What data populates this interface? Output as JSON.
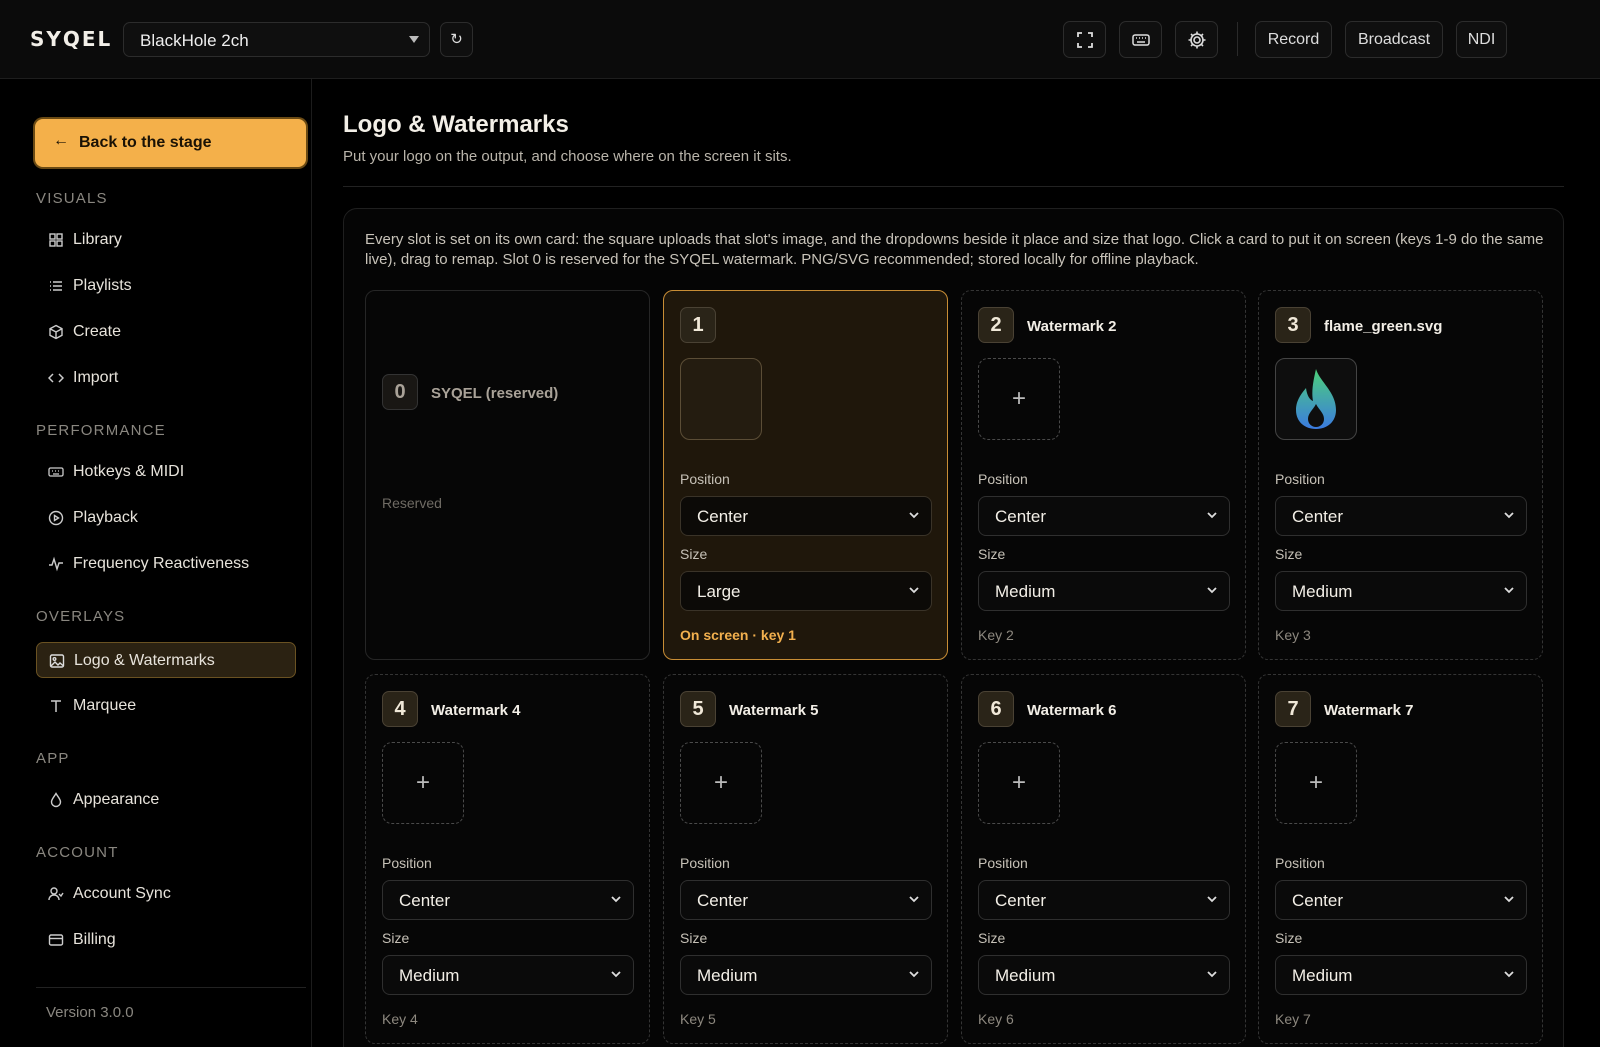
{
  "header": {
    "brand": "SYQEL",
    "audio_device": "BlackHole 2ch",
    "refresh_glyph": "↻",
    "icons": [
      "fullscreen-icon",
      "keyboard-icon",
      "gear-icon"
    ],
    "buttons": {
      "record": "Record",
      "broadcast": "Broadcast",
      "ndi": "NDI"
    }
  },
  "sidebar": {
    "back_label": "Back to the stage",
    "back_arrow": "←",
    "sections": {
      "visuals": "VISUALS",
      "performance": "PERFORMANCE",
      "overlays": "OVERLAYS",
      "app": "APP",
      "account": "ACCOUNT"
    },
    "items": {
      "library": "Library",
      "playlists": "Playlists",
      "create": "Create",
      "import": "Import",
      "hotkeys": "Hotkeys & MIDI",
      "playback": "Playback",
      "frequency": "Frequency Reactiveness",
      "logo": "Logo & Watermarks",
      "marquee": "Marquee",
      "appearance": "Appearance",
      "account_sync": "Account Sync",
      "billing": "Billing"
    },
    "version": "Version 3.0.0"
  },
  "main": {
    "title": "Logo & Watermarks",
    "subtitle": "Put your logo on the output, and choose where on the screen it sits.",
    "info": "Every slot is set on its own card: the square uploads that slot's image, and the dropdowns beside it place and size that logo. Click a card to put it on screen (keys 1-9 do the same live), drag to remap. Slot 0 is reserved for the SYQEL watermark. PNG/SVG recommended; stored locally for offline playback.",
    "position_label": "Position",
    "size_label": "Size",
    "add_glyph": "+",
    "cards": [
      {
        "num": "0",
        "name": "SYQEL (reserved)",
        "note": "Reserved"
      },
      {
        "num": "1",
        "name": "",
        "position": "Center",
        "size": "Large",
        "key": "On screen · key 1"
      },
      {
        "num": "2",
        "name": "Watermark 2",
        "position": "Center",
        "size": "Medium",
        "key": "Key 2"
      },
      {
        "num": "3",
        "name": "flame_green.svg",
        "position": "Center",
        "size": "Medium",
        "key": "Key 3"
      },
      {
        "num": "4",
        "name": "Watermark 4",
        "position": "Center",
        "size": "Medium",
        "key": "Key 4"
      },
      {
        "num": "5",
        "name": "Watermark 5",
        "position": "Center",
        "size": "Medium",
        "key": "Key 5"
      },
      {
        "num": "6",
        "name": "Watermark 6",
        "position": "Center",
        "size": "Medium",
        "key": "Key 6"
      },
      {
        "num": "7",
        "name": "Watermark 7",
        "position": "Center",
        "size": "Medium",
        "key": "Key 7"
      }
    ]
  },
  "colors": {
    "accent": "#f4b04a",
    "active_card_border": "#c88d35",
    "active_card_bg": "#1f170b",
    "background": "#000000"
  }
}
